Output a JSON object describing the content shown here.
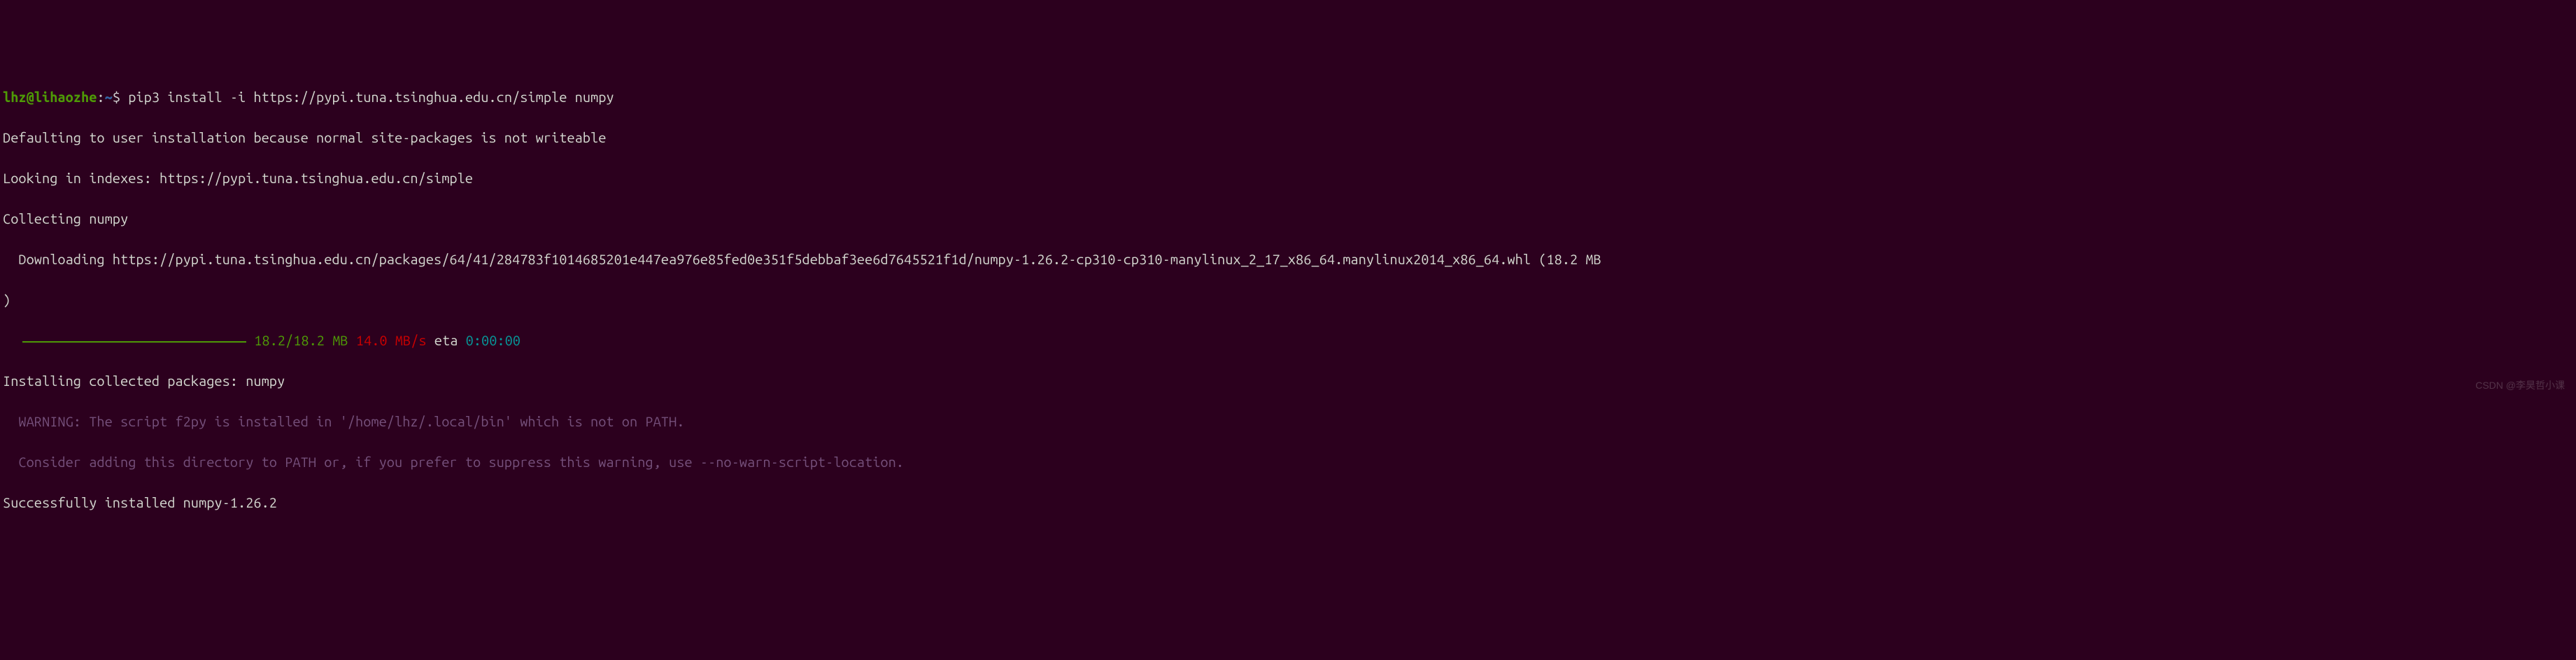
{
  "prompt": {
    "user": "lhz",
    "at": "@",
    "host": "lihaozhe",
    "colon": ":",
    "path": "~",
    "dollar": "$ ",
    "command": "pip3 install -i https://pypi.tuna.tsinghua.edu.cn/simple numpy"
  },
  "lines": {
    "defaulting": "Defaulting to user installation because normal site-packages is not writeable",
    "looking": "Looking in indexes: https://pypi.tuna.tsinghua.edu.cn/simple",
    "collecting": "Collecting numpy",
    "downloading": "  Downloading https://pypi.tuna.tsinghua.edu.cn/packages/64/41/284783f1014685201e447ea976e85fed0e351f5debbaf3ee6d7645521f1d/numpy-1.26.2-cp310-cp310-manylinux_2_17_x86_64.manylinux2014_x86_64.whl (18.2 MB",
    "paren_close": ")",
    "progress": {
      "size": " 18.2/18.2 MB",
      "speed": " 14.0 MB/s",
      "eta_label": " eta ",
      "eta_time": "0:00:00"
    },
    "installing": "Installing collected packages: numpy",
    "warning1": "  WARNING: The script f2py is installed in '/home/lhz/.local/bin' which is not on PATH.",
    "warning2": "  Consider adding this directory to PATH or, if you prefer to suppress this warning, use --no-warn-script-location.",
    "success": "Successfully installed numpy-1.26.2"
  },
  "watermark": "CSDN @李昊哲小课"
}
